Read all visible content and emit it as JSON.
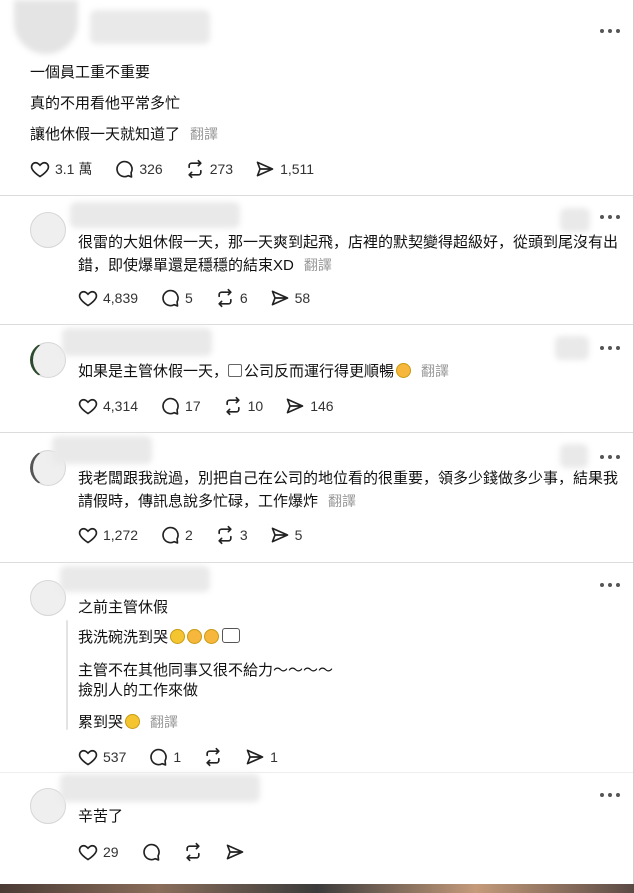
{
  "posts": [
    {
      "lines": [
        "一個員工重不重要",
        "真的不用看他平常多忙",
        "讓他休假一天就知道了"
      ],
      "translate": "翻譯",
      "likes": "3.1 萬",
      "comments": "326",
      "reposts": "273",
      "shares": "1,511"
    },
    {
      "text": "很雷的大姐休假一天，那一天爽到起飛，店裡的默契變得超級好，從頭到尾沒有出錯，即使爆單還是穩穩的結束XD",
      "translate": "翻譯",
      "likes": "4,839",
      "comments": "5",
      "reposts": "6",
      "shares": "58"
    },
    {
      "text_before": "如果是主管休假一天，",
      "text_after": "公司反而運行得更順暢",
      "translate": "翻譯",
      "likes": "4,314",
      "comments": "17",
      "reposts": "10",
      "shares": "146"
    },
    {
      "text": "我老闆跟我說過，別把自己在公司的地位看的很重要，領多少錢做多少事，結果我請假時，傳訊息說多忙碌，工作爆炸",
      "translate": "翻譯",
      "likes": "1,272",
      "comments": "2",
      "reposts": "3",
      "shares": "5"
    },
    {
      "line1": "之前主管休假",
      "line2": "我洗碗洗到哭",
      "line3": "主管不在其他同事又很不給力～～～～",
      "line4": "撿別人的工作來做",
      "line5": "累到哭",
      "translate": "翻譯",
      "likes": "537",
      "comments": "1",
      "shares": "1"
    },
    {
      "text": "辛苦了",
      "likes": "29"
    }
  ]
}
